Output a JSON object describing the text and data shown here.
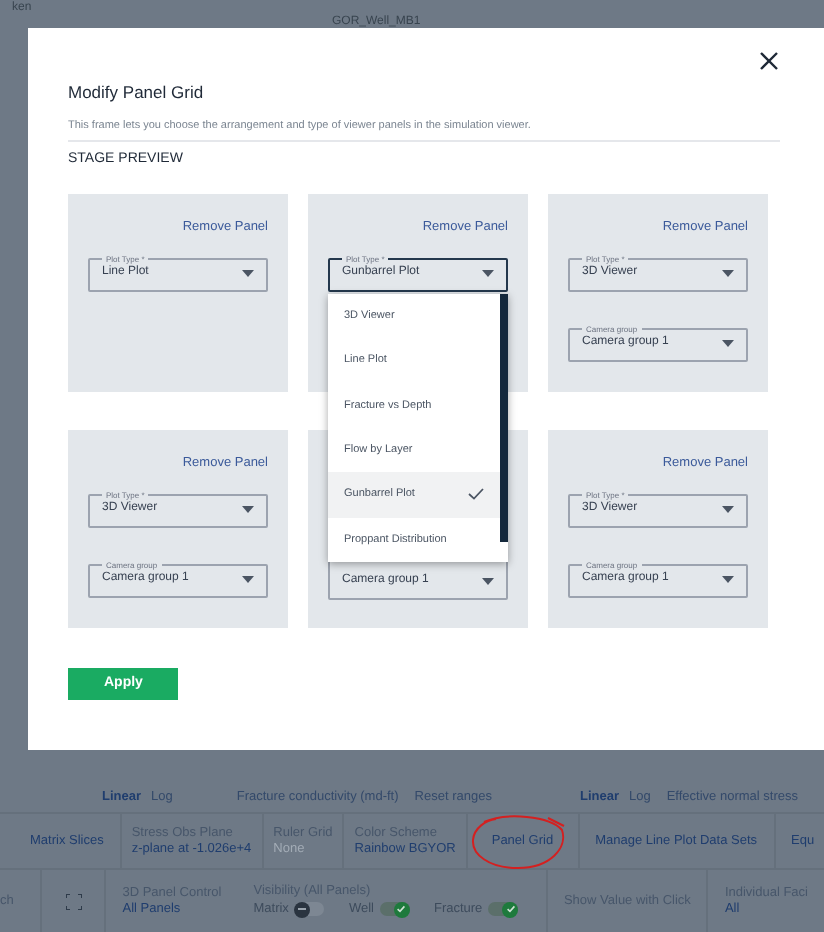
{
  "background": {
    "top_texts": [
      "ken",
      "GOR_Well_MB1"
    ],
    "axis_row": [
      {
        "kind": "scale",
        "bold": "Linear",
        "plain": "Log"
      },
      {
        "kind": "text",
        "text": "Fracture conductivity (md-ft)"
      },
      {
        "kind": "text",
        "text": "Reset ranges"
      },
      {
        "kind": "scale",
        "bold": "Linear",
        "plain": "Log"
      },
      {
        "kind": "text",
        "text": "Effective normal stress"
      }
    ],
    "toolbar": [
      {
        "label": "Matrix Slices"
      },
      {
        "label": "Stress Obs Plane",
        "value": "z-plane at -1.026e+4",
        "disabled": false
      },
      {
        "label": "Ruler Grid",
        "value": "None",
        "disabled": true
      },
      {
        "label": "Color Scheme",
        "value": "Rainbow BGYOR",
        "disabled": false
      },
      {
        "label": "Panel Grid",
        "circled": true
      },
      {
        "label": "Manage Line Plot Data Sets"
      },
      {
        "label": "Equ"
      }
    ],
    "controls": {
      "search_fragment": "ch",
      "panel_control": {
        "label": "3D Panel Control",
        "value": "All Panels"
      },
      "visibility": {
        "label": "Visibility (All Panels)",
        "toggles": [
          {
            "label": "Matrix",
            "on": false
          },
          {
            "label": "Well",
            "on": true
          },
          {
            "label": "Fracture",
            "on": true
          }
        ]
      },
      "show_value": "Show Value with Click",
      "facies": {
        "label": "Individual Faci",
        "value": "All"
      }
    }
  },
  "dialog": {
    "title": "Modify Panel Grid",
    "description": "This frame lets you choose the arrangement and type of viewer panels in the simulation viewer.",
    "section": "STAGE PREVIEW",
    "panels": [
      {
        "remove": "Remove Panel",
        "plot_type": {
          "label": "Plot Type *",
          "value": "Line Plot",
          "focused": false
        }
      },
      {
        "remove": "Remove Panel",
        "plot_type": {
          "label": "Plot Type *",
          "value": "Gunbarrel Plot",
          "focused": true
        },
        "dropdown": [
          {
            "label": "3D Viewer",
            "selected": false
          },
          {
            "label": "Line Plot",
            "selected": false
          },
          {
            "label": "Fracture vs Depth",
            "selected": false
          },
          {
            "label": "Flow by Layer",
            "selected": false
          },
          {
            "label": "Gunbarrel Plot",
            "selected": true
          },
          {
            "label": "Proppant Distribution",
            "selected": false
          }
        ]
      },
      {
        "remove": "Remove Panel",
        "plot_type": {
          "label": "Plot Type *",
          "value": "3D Viewer",
          "focused": false
        },
        "camera_group": {
          "label": "Camera group",
          "value": "Camera group 1"
        }
      },
      {
        "remove": "Remove Panel",
        "plot_type": {
          "label": "Plot Type *",
          "value": "3D Viewer",
          "focused": false
        },
        "camera_group": {
          "label": "Camera group",
          "value": "Camera group 1"
        }
      },
      {
        "camera_group": {
          "value": "Camera group 1"
        }
      },
      {
        "remove": "Remove Panel",
        "plot_type": {
          "label": "Plot Type *",
          "value": "3D Viewer",
          "focused": false
        },
        "camera_group": {
          "label": "Camera group",
          "value": "Camera group 1"
        }
      }
    ],
    "apply": "Apply"
  }
}
